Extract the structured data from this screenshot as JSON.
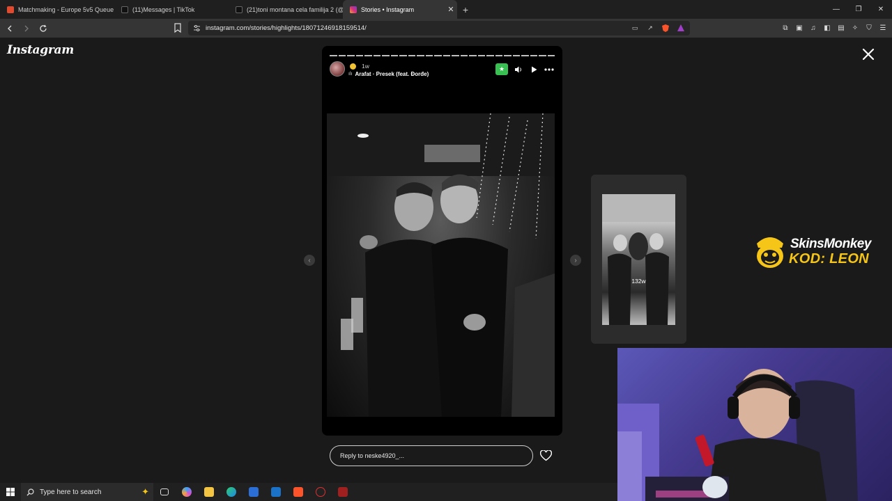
{
  "browser": {
    "tabs": [
      {
        "title": "Matchmaking - Europe 5v5 Queue - F",
        "favicon_color": "#e04a2f",
        "active": false
      },
      {
        "title": "(11)Messages | TikTok",
        "favicon_color": "#111111",
        "active": false
      },
      {
        "title": "(21)toni montana cela familija 2 (@to",
        "favicon_color": "#111111",
        "active": false
      },
      {
        "title": "Stories • Instagram",
        "favicon_color": "#d6307a",
        "active": true
      }
    ],
    "new_tab_label": "+",
    "url": "instagram.com/stories/highlights/18071246918159514/"
  },
  "page": {
    "logo_text": "Instagram",
    "story": {
      "time_ago": "1w",
      "music": "Arafat · Presek (feat. Đorđe)",
      "reply_placeholder": "Reply to neske4920_..."
    },
    "next_preview": {
      "time_ago": "132w"
    },
    "sponsor": {
      "line1": "SkinsMonkey",
      "line2": "KOD: LEON"
    }
  },
  "taskbar": {
    "search_placeholder": "Type here to search"
  },
  "colors": {
    "story_badge": "#38c152",
    "sponsor_yellow": "#f5c518",
    "webcam_bg": "#4a40a0"
  }
}
